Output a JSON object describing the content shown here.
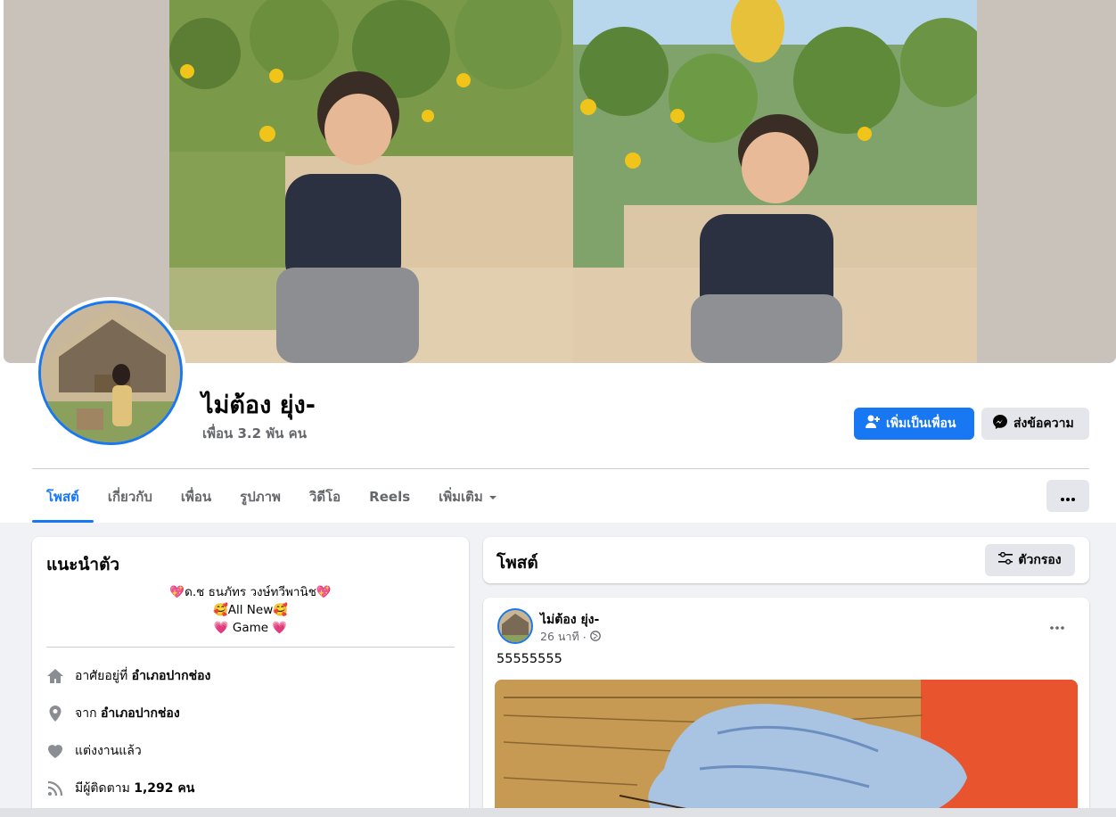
{
  "profile": {
    "name": "ไม่ต้อง ยุ่ง-",
    "friends": "เพื่อน 3.2 พัน คน"
  },
  "actions": {
    "add_friend": "เพิ่มเป็นเพื่อน",
    "message": "ส่งข้อความ"
  },
  "tabs": [
    {
      "label": "โพสต์",
      "active": true
    },
    {
      "label": "เกี่ยวกับ"
    },
    {
      "label": "เพื่อน"
    },
    {
      "label": "รูปภาพ"
    },
    {
      "label": "วิดีโอ"
    },
    {
      "label": "Reels"
    },
    {
      "label": "เพิ่มเติม"
    }
  ],
  "intro": {
    "title": "แนะนำตัว",
    "bio_lines": [
      "💖ด.ช ธนภัทร วงษ์ทวีพานิช💖",
      "🥰All New🥰",
      "💗 Game 💗"
    ],
    "lives_prefix": "อาศัยอยู่ที่",
    "lives_place": "อำเภอปากช่อง",
    "from_prefix": "จาก",
    "from_place": "อำเภอปากช่อง",
    "relationship": "แต่งงานแล้ว",
    "followers_prefix": "มีผู้ติดตาม",
    "followers_count": "1,292 คน"
  },
  "posts": {
    "title": "โพสต์",
    "filter": "ตัวกรอง"
  },
  "post": {
    "author": "ไม่ต้อง ยุ่ง-",
    "time": "26 นาที",
    "separator": "·",
    "text": "55555555"
  },
  "colors": {
    "accent": "#1877f2",
    "background": "#f0f2f5",
    "secondary_button": "#e4e6eb"
  }
}
